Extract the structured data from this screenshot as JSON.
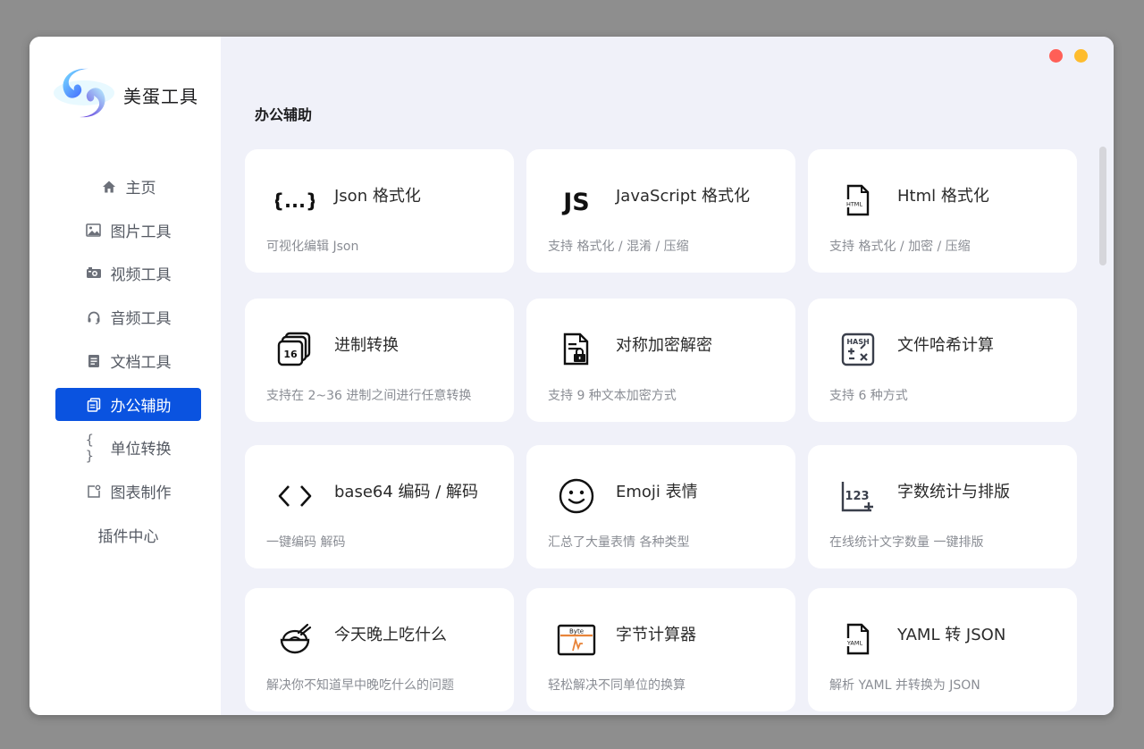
{
  "app": {
    "title": "美蛋工具"
  },
  "colors": {
    "accent": "#0a53e0",
    "close_dot": "#ff5f57",
    "minimize_dot": "#febc2e"
  },
  "sidebar": {
    "items": [
      {
        "label": "主页",
        "icon": "home-icon"
      },
      {
        "label": "图片工具",
        "icon": "image-icon"
      },
      {
        "label": "视频工具",
        "icon": "video-icon"
      },
      {
        "label": "音频工具",
        "icon": "headset-icon"
      },
      {
        "label": "文档工具",
        "icon": "document-icon"
      },
      {
        "label": "办公辅助",
        "icon": "copy-icon",
        "active": true
      },
      {
        "label": "单位转换",
        "icon": "braces-icon"
      },
      {
        "label": "图表制作",
        "icon": "chart-icon"
      },
      {
        "label": "插件中心",
        "icon": ""
      }
    ]
  },
  "main": {
    "section_title": "办公辅助",
    "cards": [
      {
        "title": "Json 格式化",
        "desc": "可视化编辑 Json",
        "icon": "json-braces-icon"
      },
      {
        "title": "JavaScript 格式化",
        "desc": "支持 格式化 / 混淆 / 压缩",
        "icon": "js-icon"
      },
      {
        "title": "Html 格式化",
        "desc": "支持 格式化 / 加密 / 压缩",
        "icon": "html-file-icon"
      },
      {
        "title": "进制转换",
        "desc": "支持在 2~36 进制之间进行任意转换",
        "icon": "base-16-icon"
      },
      {
        "title": "对称加密解密",
        "desc": "支持 9 种文本加密方式",
        "icon": "encrypted-file-icon"
      },
      {
        "title": "文件哈希计算",
        "desc": "支持 6 种方式",
        "icon": "hash-calculator-icon"
      },
      {
        "title": "base64 编码 / 解码",
        "desc": "一键编码 解码",
        "icon": "code-brackets-icon"
      },
      {
        "title": "Emoji 表情",
        "desc": "汇总了大量表情 各种类型",
        "icon": "smiley-icon"
      },
      {
        "title": "字数统计与排版",
        "desc": "在线统计文字数量 一键排版",
        "icon": "word-count-icon"
      },
      {
        "title": "今天晚上吃什么",
        "desc": "解决你不知道早中晚吃什么的问题",
        "icon": "bowl-icon"
      },
      {
        "title": "字节计算器",
        "desc": "轻松解决不同单位的换算",
        "icon": "byte-meter-icon"
      },
      {
        "title": "YAML 转 JSON",
        "desc": "解析 YAML 并转换为 JSON",
        "icon": "yaml-file-icon"
      }
    ]
  },
  "icon_labels": {
    "html": "HTML",
    "hash": "HASH",
    "base": "16",
    "word_count": "123",
    "byte": "Byte",
    "yaml": "YAML",
    "js": "JS"
  }
}
